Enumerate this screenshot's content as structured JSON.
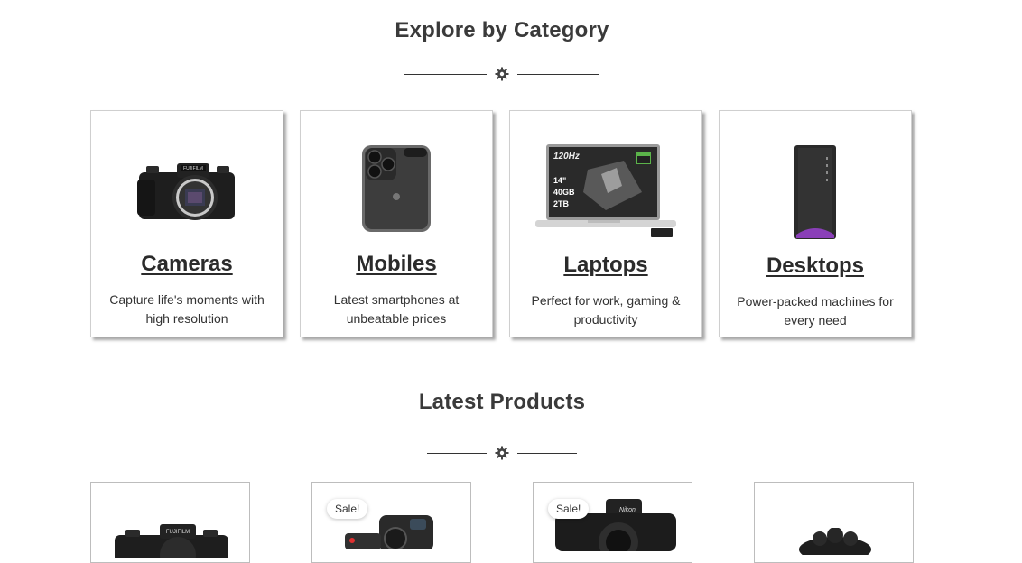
{
  "categories_section": {
    "title": "Explore by Category",
    "divider_icon": "gear-icon"
  },
  "categories": [
    {
      "title": "Cameras",
      "description": "Capture life's moments with high resolution",
      "image": "mirrorless-camera-image"
    },
    {
      "title": "Mobiles",
      "description": "Latest smartphones at unbeatable prices",
      "image": "smartphone-image"
    },
    {
      "title": "Laptops",
      "description": "Perfect for work, gaming & productivity",
      "image": "laptop-image",
      "screen_text": [
        "120Hz",
        "14\"",
        "40GB",
        "2TB"
      ]
    },
    {
      "title": "Desktops",
      "description": "Power-packed machines for every need",
      "image": "desktop-tower-image"
    }
  ],
  "products_section": {
    "title": "Latest Products",
    "divider_icon": "gear-icon"
  },
  "products": [
    {
      "badge": "",
      "image": "camera-product-image"
    },
    {
      "badge": "Sale!",
      "image": "action-camera-product-image"
    },
    {
      "badge": "Sale!",
      "image": "dslr-camera-product-image"
    },
    {
      "badge": "",
      "image": "microphone-product-image"
    }
  ],
  "colors": {
    "heading": "#3a3a3a",
    "card_border": "#cfcfcf",
    "text": "#333333"
  }
}
